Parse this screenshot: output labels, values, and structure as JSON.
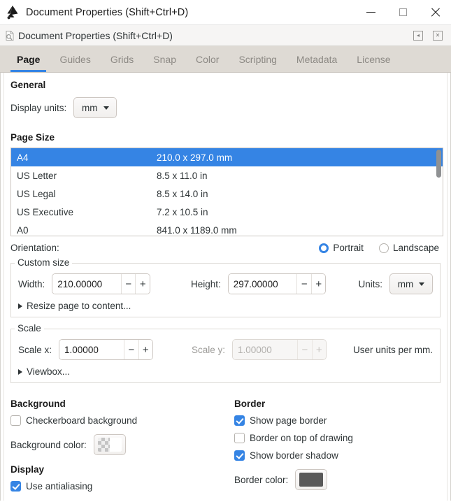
{
  "window": {
    "title": "Document Properties (Shift+Ctrl+D)",
    "app_icon": "inkscape-logo-icon",
    "minimize_label": "—",
    "maximize_label": "□",
    "close_label": "✕"
  },
  "dock": {
    "title": "Document Properties (Shift+Ctrl+D)",
    "icon": "document-properties-icon",
    "collapse_label": "◂",
    "close_label": "✕"
  },
  "tabs": [
    {
      "label": "Page",
      "active": true
    },
    {
      "label": "Guides",
      "active": false
    },
    {
      "label": "Grids",
      "active": false
    },
    {
      "label": "Snap",
      "active": false
    },
    {
      "label": "Color",
      "active": false
    },
    {
      "label": "Scripting",
      "active": false
    },
    {
      "label": "Metadata",
      "active": false
    },
    {
      "label": "License",
      "active": false
    }
  ],
  "general": {
    "heading": "General",
    "display_units_label": "Display units:",
    "display_units_value": "mm"
  },
  "page_size": {
    "heading": "Page Size",
    "rows": [
      {
        "name": "A4",
        "dims": "210.0 x 297.0 mm",
        "selected": true
      },
      {
        "name": "US Letter",
        "dims": "8.5 x 11.0 in",
        "selected": false
      },
      {
        "name": "US Legal",
        "dims": "8.5 x 14.0 in",
        "selected": false
      },
      {
        "name": "US Executive",
        "dims": "7.2 x 10.5 in",
        "selected": false
      },
      {
        "name": "A0",
        "dims": "841.0 x 1189.0 mm",
        "selected": false
      }
    ]
  },
  "orientation": {
    "label": "Orientation:",
    "portrait_label": "Portrait",
    "landscape_label": "Landscape",
    "selected": "Portrait"
  },
  "custom_size": {
    "legend": "Custom size",
    "width_label": "Width:",
    "width_value": "210.00000",
    "height_label": "Height:",
    "height_value": "297.00000",
    "units_label": "Units:",
    "units_value": "mm",
    "resize_expander": "Resize page to content...",
    "minus": "−",
    "plus": "+"
  },
  "scale": {
    "legend": "Scale",
    "scale_x_label": "Scale x:",
    "scale_x_value": "1.00000",
    "scale_y_label": "Scale y:",
    "scale_y_value": "1.00000",
    "scale_y_disabled": true,
    "units_note": "User units per mm.",
    "viewbox_expander": "Viewbox...",
    "minus": "−",
    "plus": "+"
  },
  "background": {
    "heading": "Background",
    "checkerboard_label": "Checkerboard background",
    "checkerboard_checked": false,
    "color_label": "Background color:",
    "color_swatch": "checkerboard-white"
  },
  "display": {
    "heading": "Display",
    "antialias_label": "Use antialiasing",
    "antialias_checked": true
  },
  "border": {
    "heading": "Border",
    "show_page_border_label": "Show page border",
    "show_page_border_checked": true,
    "border_on_top_label": "Border on top of drawing",
    "border_on_top_checked": false,
    "show_shadow_label": "Show border shadow",
    "show_shadow_checked": true,
    "color_label": "Border color:",
    "color_value": "#595959"
  },
  "colors": {
    "accent": "#3584e4",
    "tabbar_bg": "#dedad4",
    "subheader_bg": "#f6f5f4",
    "border_swatch": "#595959"
  }
}
